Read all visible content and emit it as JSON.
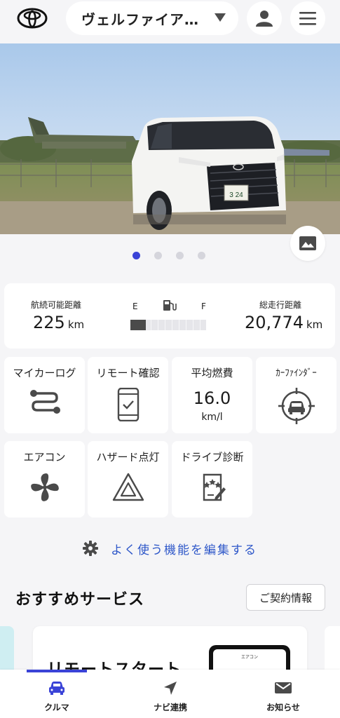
{
  "header": {
    "logo_icon": "toyota-logo",
    "vehicle_name": "ヴェルファイア…",
    "account_icon": "person-icon",
    "menu_icon": "hamburger-menu-icon"
  },
  "hero": {
    "photo_icon": "image-icon",
    "plate": "3 24",
    "carousel_count": 4,
    "carousel_active_index": 0
  },
  "stats": {
    "range_label": "航続可能距離",
    "range_value": "225",
    "range_unit": "km",
    "fuel_empty": "E",
    "fuel_full": "F",
    "fuel_icon": "fuel-pump-icon",
    "fuel_level": 0.2,
    "odometer_label": "総走行距離",
    "odometer_value": "20,774",
    "odometer_unit": "km"
  },
  "tiles": {
    "mycar_log": {
      "label": "マイカーログ",
      "icon": "route-icon"
    },
    "remote_check": {
      "label": "リモート確認",
      "icon": "phone-check-icon"
    },
    "avg_fuel": {
      "label": "平均燃費",
      "value": "16.0",
      "unit": "km/l"
    },
    "car_finder": {
      "label": "ｶｰﾌｧｲﾝﾀﾞｰ",
      "icon": "car-finder-icon"
    },
    "aircon": {
      "label": "エアコン",
      "icon": "fan-icon"
    },
    "hazard": {
      "label": "ハザード点灯",
      "icon": "hazard-triangle-icon"
    },
    "drive_diag": {
      "label": "ドライブ診断",
      "icon": "rating-document-icon"
    }
  },
  "edit_link": {
    "icon": "gear-icon",
    "label": "よく使う機能を編集する"
  },
  "recommended": {
    "title": "おすすめサービス",
    "contract_button": "ご契約情報",
    "card_title": "リモートスタート",
    "card_phone_text": "エアコン"
  },
  "bottom_nav": {
    "items": [
      {
        "label": "クルマ",
        "icon": "car-icon"
      },
      {
        "label": "ナビ連携",
        "icon": "navigation-arrow-icon"
      },
      {
        "label": "お知らせ",
        "icon": "mail-icon"
      }
    ],
    "accent_color": "#3a43d7"
  }
}
